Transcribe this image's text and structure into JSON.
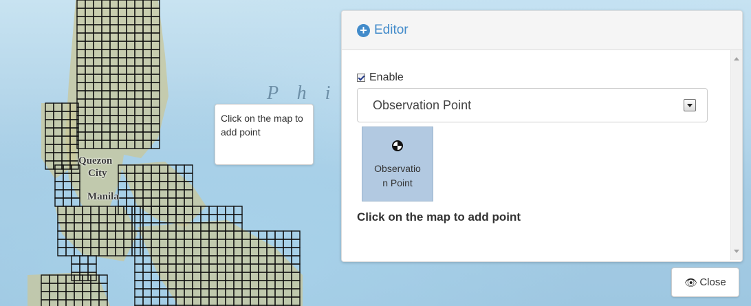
{
  "map": {
    "sea_label": "P h i",
    "places": [
      "Quezon",
      "City",
      "Manila"
    ]
  },
  "tooltip": {
    "text": "Click on the map to add point"
  },
  "editor": {
    "title": "Editor",
    "enable_label": "Enable",
    "enable_checked": true,
    "select_value": "Observation Point",
    "tool_label": "Observation Point",
    "hint": "Click on the map to add point"
  },
  "close_button": {
    "label": "Close"
  },
  "colors": {
    "accent": "#428bca",
    "tool_bg": "#b2c9e1",
    "grid_stroke": "#111111"
  },
  "icons": [
    "plus-circle-icon",
    "observation-point-icon",
    "eye-slash-icon",
    "chevron-down-icon"
  ]
}
